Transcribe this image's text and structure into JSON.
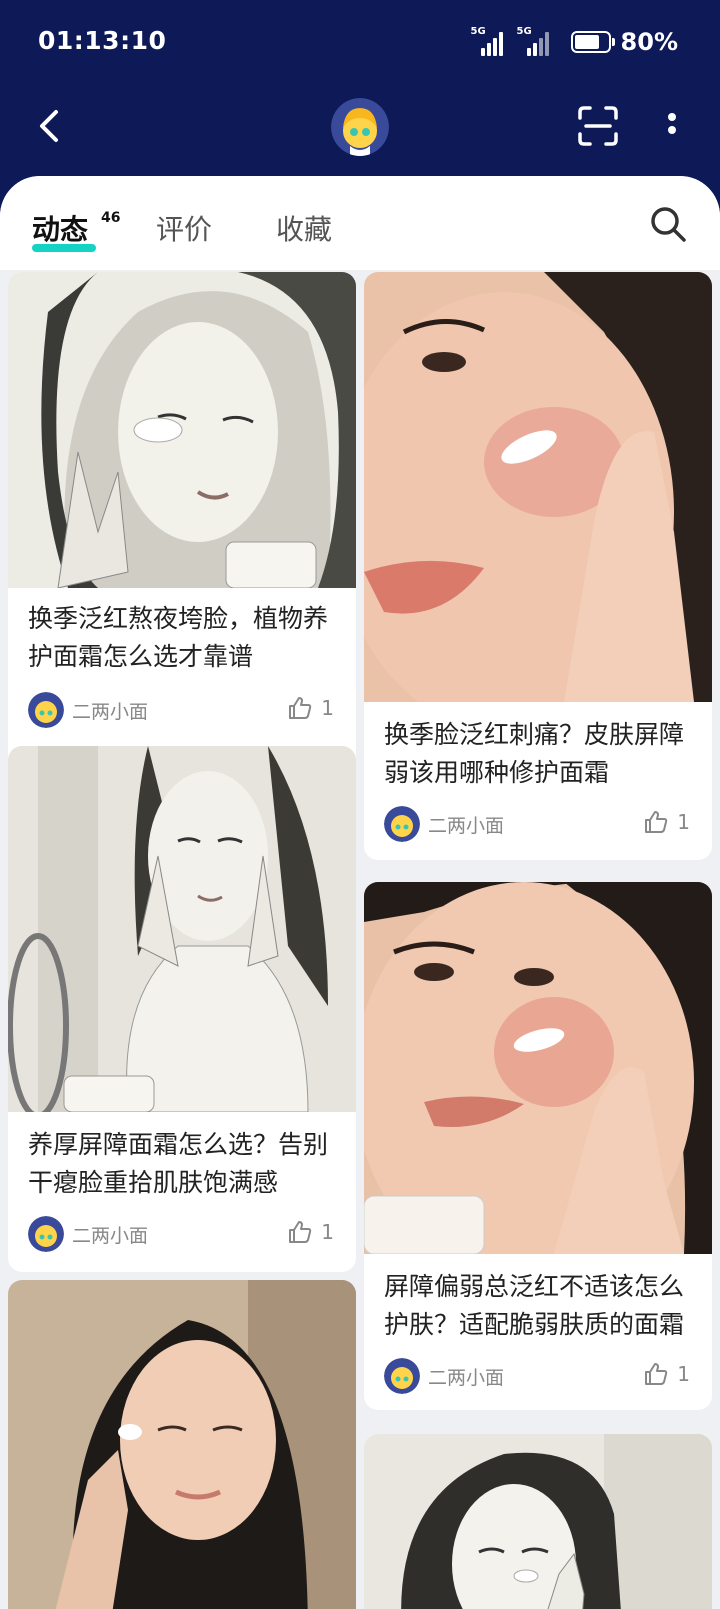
{
  "status_bar": {
    "time": "01:13:10",
    "signal_1": "5G",
    "signal_2": "5G",
    "battery_level": 0.8,
    "battery": "80%"
  },
  "header": {
    "back_icon": "chevron-left-icon",
    "avatar_icon": "cartoon-avatar",
    "scan_icon": "scan-icon",
    "more_icon": "more-vertical-icon"
  },
  "tabs": [
    {
      "label": "动态",
      "count": "46",
      "active": true
    },
    {
      "label": "评价"
    },
    {
      "label": "收藏"
    }
  ],
  "search_icon": "search-icon",
  "accent_color": "#14d2c4",
  "header_bg": "#0e1a57",
  "feed": {
    "left": [
      {
        "title": "换季泛红熬夜垮脸，植物养护面霜怎么选才靠谱",
        "author": "二两小面",
        "likes": "1"
      },
      {
        "title": "养厚屏障面霜怎么选？告别干瘪脸重拾肌肤饱满感",
        "author": "二两小面",
        "likes": "1"
      },
      {
        "title": ""
      }
    ],
    "right": [
      {
        "title": "换季脸泛红刺痛？皮肤屏障弱该用哪种修护面霜",
        "author": "二两小面",
        "likes": "1"
      },
      {
        "title": "屏障偏弱总泛红不适该怎么护肤？适配脆弱肤质的面霜",
        "author": "二两小面",
        "likes": "1"
      },
      {
        "title": ""
      }
    ]
  }
}
